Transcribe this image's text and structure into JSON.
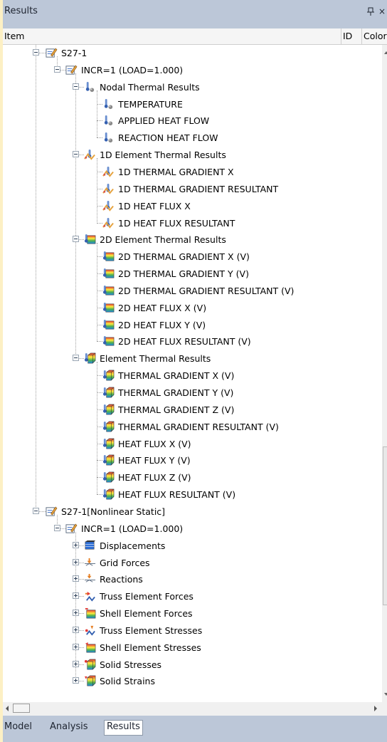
{
  "panel": {
    "title": "Results",
    "pin_icon": "pin-icon",
    "close_icon": "close-icon",
    "close_glyph": "×"
  },
  "columns": {
    "item": "Item",
    "id": "ID",
    "color": "Color"
  },
  "tree": [
    {
      "label": "S27-1",
      "level": 0,
      "icon": "subcase-edit-icon",
      "expander": "minus"
    },
    {
      "label": "INCR=1 (LOAD=1.000)",
      "level": 1,
      "icon": "increment-edit-icon",
      "expander": "minus"
    },
    {
      "label": "Nodal Thermal Results",
      "level": 2,
      "icon": "nodal-thermal-icon",
      "expander": "minus"
    },
    {
      "label": "TEMPERATURE",
      "level": 3,
      "icon": "nodal-thermal-icon",
      "expander": null
    },
    {
      "label": "APPLIED HEAT FLOW",
      "level": 3,
      "icon": "nodal-thermal-icon",
      "expander": null
    },
    {
      "label": "REACTION HEAT FLOW",
      "level": 3,
      "icon": "nodal-thermal-icon",
      "expander": null
    },
    {
      "label": "1D Element Thermal Results",
      "level": 2,
      "icon": "1d-thermal-icon",
      "expander": "minus"
    },
    {
      "label": "1D THERMAL GRADIENT X",
      "level": 3,
      "icon": "1d-thermal-icon",
      "expander": null
    },
    {
      "label": "1D THERMAL GRADIENT RESULTANT",
      "level": 3,
      "icon": "1d-thermal-icon",
      "expander": null
    },
    {
      "label": "1D HEAT FLUX X",
      "level": 3,
      "icon": "1d-thermal-icon",
      "expander": null
    },
    {
      "label": "1D HEAT FLUX RESULTANT",
      "level": 3,
      "icon": "1d-thermal-icon",
      "expander": null
    },
    {
      "label": "2D Element Thermal Results",
      "level": 2,
      "icon": "2d-thermal-icon",
      "expander": "minus"
    },
    {
      "label": "2D THERMAL GRADIENT X (V)",
      "level": 3,
      "icon": "2d-thermal-icon",
      "expander": null
    },
    {
      "label": "2D THERMAL GRADIENT Y (V)",
      "level": 3,
      "icon": "2d-thermal-icon",
      "expander": null
    },
    {
      "label": "2D THERMAL GRADIENT RESULTANT (V)",
      "level": 3,
      "icon": "2d-thermal-icon",
      "expander": null
    },
    {
      "label": "2D HEAT FLUX X (V)",
      "level": 3,
      "icon": "2d-thermal-icon",
      "expander": null
    },
    {
      "label": "2D HEAT FLUX Y (V)",
      "level": 3,
      "icon": "2d-thermal-icon",
      "expander": null
    },
    {
      "label": "2D HEAT FLUX RESULTANT (V)",
      "level": 3,
      "icon": "2d-thermal-icon",
      "expander": null
    },
    {
      "label": "Element Thermal Results",
      "level": 2,
      "icon": "solid-thermal-icon",
      "expander": "minus"
    },
    {
      "label": "THERMAL GRADIENT X (V)",
      "level": 3,
      "icon": "solid-thermal-icon",
      "expander": null
    },
    {
      "label": "THERMAL GRADIENT Y (V)",
      "level": 3,
      "icon": "solid-thermal-icon",
      "expander": null
    },
    {
      "label": "THERMAL GRADIENT Z (V)",
      "level": 3,
      "icon": "solid-thermal-icon",
      "expander": null
    },
    {
      "label": "THERMAL GRADIENT RESULTANT (V)",
      "level": 3,
      "icon": "solid-thermal-icon",
      "expander": null
    },
    {
      "label": "HEAT FLUX X (V)",
      "level": 3,
      "icon": "solid-thermal-icon",
      "expander": null
    },
    {
      "label": "HEAT FLUX Y (V)",
      "level": 3,
      "icon": "solid-thermal-icon",
      "expander": null
    },
    {
      "label": "HEAT FLUX Z (V)",
      "level": 3,
      "icon": "solid-thermal-icon",
      "expander": null
    },
    {
      "label": "HEAT FLUX RESULTANT (V)",
      "level": 3,
      "icon": "solid-thermal-icon",
      "expander": null
    },
    {
      "label": "S27-1[Nonlinear Static]",
      "level": 0,
      "icon": "subcase-edit-icon",
      "expander": "minus"
    },
    {
      "label": "INCR=1 (LOAD=1.000)",
      "level": 1,
      "icon": "increment-edit-icon",
      "expander": "minus"
    },
    {
      "label": "Displacements",
      "level": 2,
      "icon": "displacement-icon",
      "expander": "plus"
    },
    {
      "label": "Grid Forces",
      "level": 2,
      "icon": "grid-force-icon",
      "expander": "plus"
    },
    {
      "label": "Reactions",
      "level": 2,
      "icon": "reaction-icon",
      "expander": "plus"
    },
    {
      "label": "Truss Element Forces",
      "level": 2,
      "icon": "truss-force-icon",
      "expander": "plus"
    },
    {
      "label": "Shell Element Forces",
      "level": 2,
      "icon": "shell-force-icon",
      "expander": "plus"
    },
    {
      "label": "Truss Element Stresses",
      "level": 2,
      "icon": "truss-stress-icon",
      "expander": "plus"
    },
    {
      "label": "Shell Element Stresses",
      "level": 2,
      "icon": "shell-stress-icon",
      "expander": "plus"
    },
    {
      "label": "Solid Stresses",
      "level": 2,
      "icon": "solid-stress-icon",
      "expander": "plus"
    },
    {
      "label": "Solid Strains",
      "level": 2,
      "icon": "solid-strain-icon",
      "expander": "plus"
    }
  ],
  "tabs": [
    {
      "label": "Model",
      "active": false
    },
    {
      "label": "Analysis",
      "active": false
    },
    {
      "label": "Results",
      "active": true
    }
  ],
  "colors": {
    "titlebar": "#bcc7d8",
    "background": "#fdf0c4",
    "tree_background": "#ffffff"
  }
}
